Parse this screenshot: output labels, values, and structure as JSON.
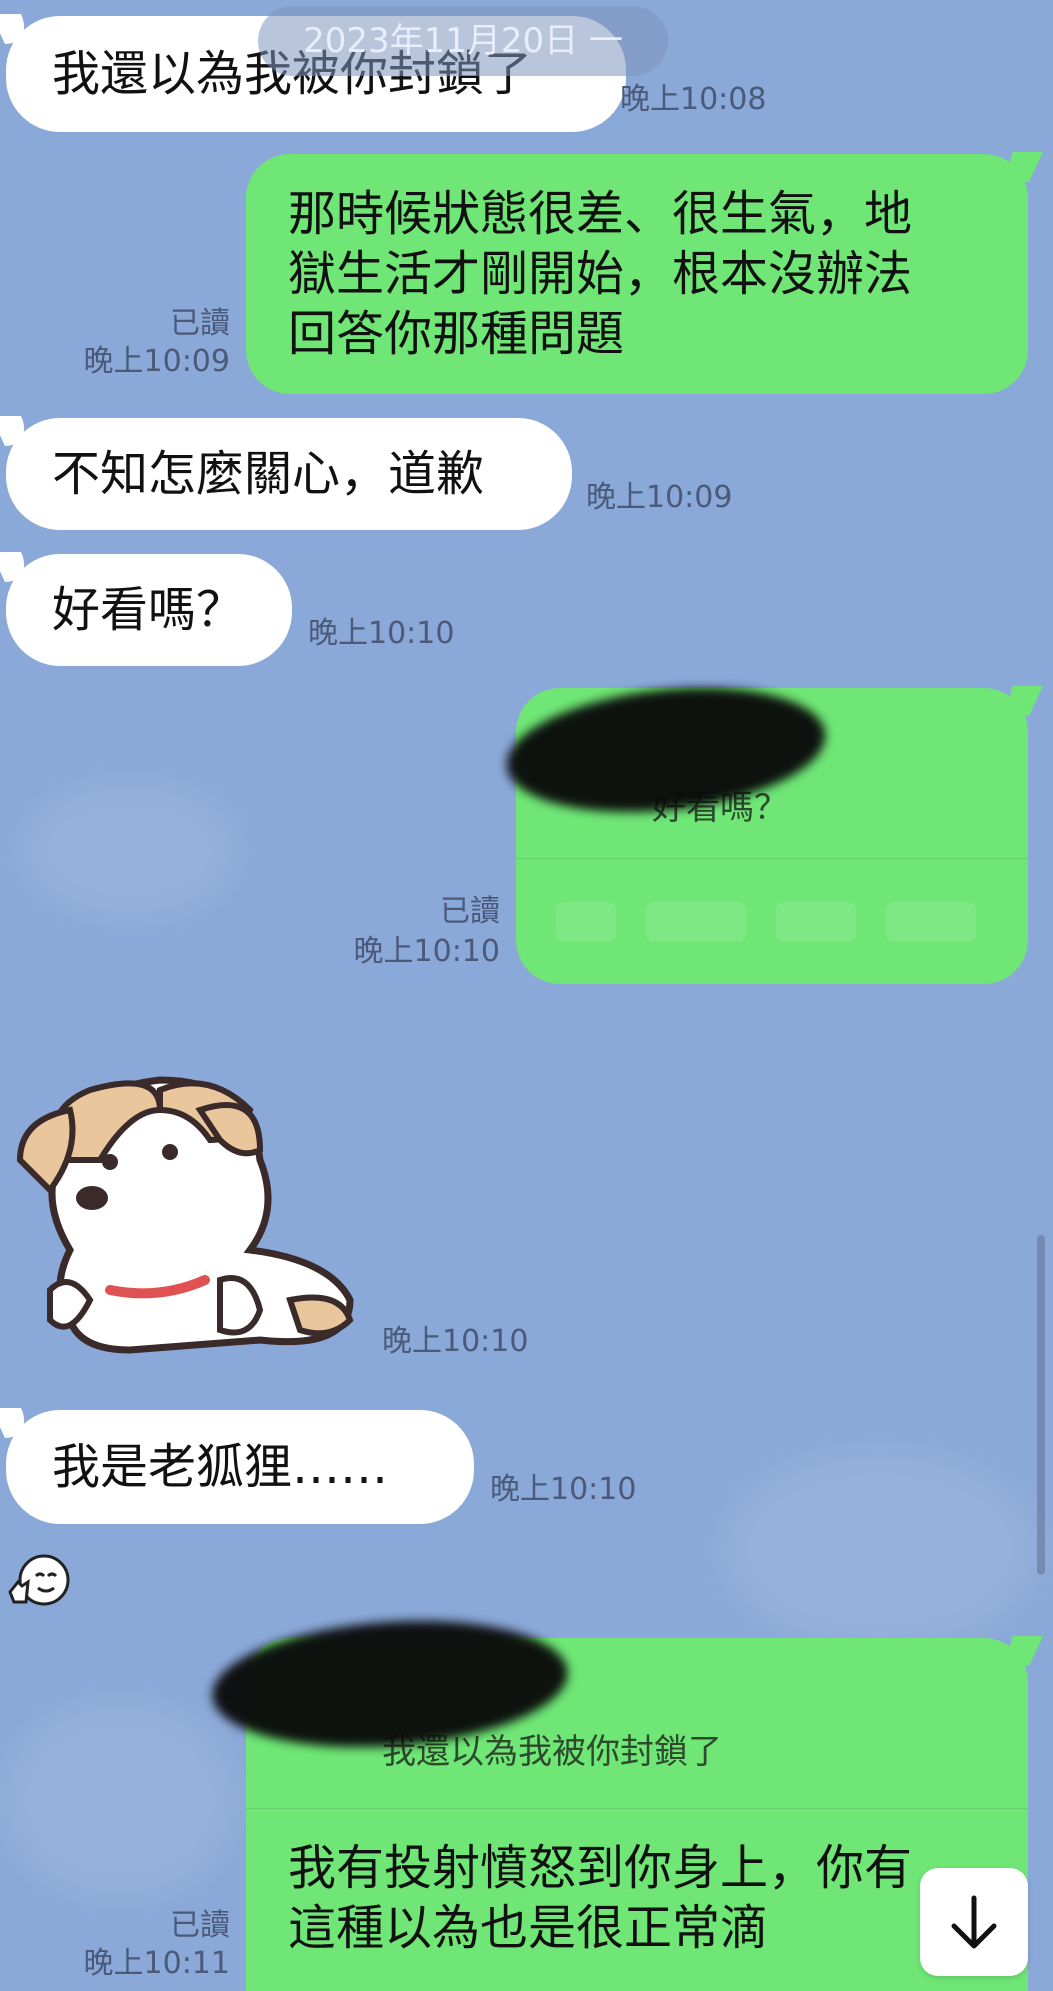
{
  "date_header": "2023年11月20日 一",
  "messages": [
    {
      "type": "in",
      "text": "我還以為我被你封鎖了",
      "time": "晚上10:08"
    },
    {
      "type": "out",
      "lines": [
        "那時候狀態很差、很生氣，地",
        "獄生活才剛開始，根本沒辦法",
        "回答你那種問題"
      ],
      "read": "已讀",
      "time": "晚上10:09"
    },
    {
      "type": "in",
      "text": "不知怎麼關心，道歉",
      "time": "晚上10:09"
    },
    {
      "type": "in",
      "text": "好看嗎？",
      "time": "晚上10:10"
    },
    {
      "type": "out-reply",
      "reply_text": "好看嗎？",
      "read": "已讀",
      "time": "晚上10:10"
    },
    {
      "type": "sticker",
      "time": "晚上10:10",
      "icon": "puppy-sticker-icon"
    },
    {
      "type": "in",
      "text": "我是老狐狸……",
      "time": "晚上10:10",
      "reaction_icon": "thumbs-up-face-icon"
    },
    {
      "type": "out-reply",
      "reply_text": "我還以為我被你封鎖了",
      "lines": [
        "我有投射憤怒到你身上，你有",
        "這種以為也是很正常滴"
      ],
      "read": "已讀",
      "time": "晚上10:11"
    }
  ],
  "colors": {
    "background": "#8aa8d8",
    "incoming_bubble": "#ffffff",
    "outgoing_bubble": "#6fe676"
  },
  "scroll_down_icon": "arrow-down-icon"
}
